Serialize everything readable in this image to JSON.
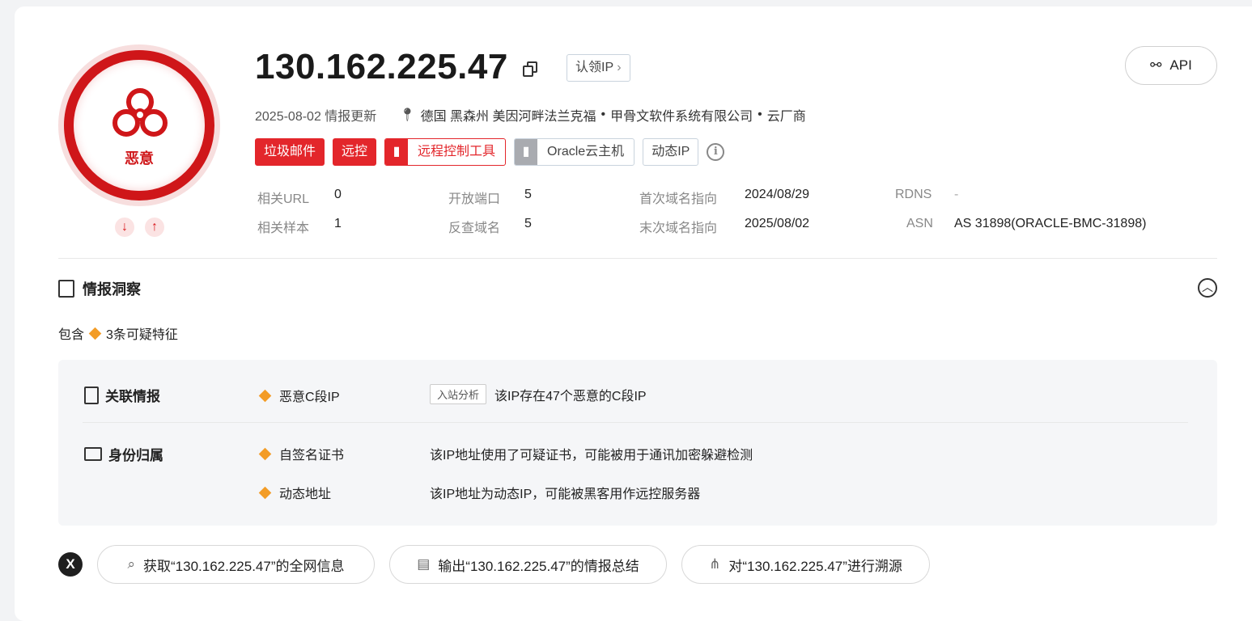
{
  "verdict": "恶意",
  "ip": "130.162.225.47",
  "claim_label": "认领IP",
  "api_label": "API",
  "meta": {
    "updated": "2025-08-02 情报更新",
    "location": "德国 黑森州 美因河畔法兰克福",
    "org": "甲骨文软件系统有限公司",
    "type": "云厂商"
  },
  "tags": [
    {
      "label": "垃圾邮件"
    },
    {
      "label": "远控"
    },
    {
      "label": "远程控制工具"
    },
    {
      "label": "Oracle云主机"
    },
    {
      "label": "动态IP"
    }
  ],
  "stats": {
    "related_url": {
      "label": "相关URL",
      "value": "0"
    },
    "open_ports": {
      "label": "开放端口",
      "value": "5"
    },
    "first_domain": {
      "label": "首次域名指向",
      "value": "2024/08/29"
    },
    "rdns": {
      "label": "RDNS",
      "value": "-"
    },
    "related_samples": {
      "label": "相关样本",
      "value": "1"
    },
    "reverse_domains": {
      "label": "反查域名",
      "value": "5"
    },
    "last_domain": {
      "label": "末次域名指向",
      "value": "2025/08/02"
    },
    "asn": {
      "label": "ASN",
      "value": "AS 31898(ORACLE-BMC-31898)"
    }
  },
  "insight": {
    "title": "情报洞察",
    "contain_prefix": "包含",
    "contain_count": "3条可疑特征",
    "groups": [
      {
        "title": "关联情报",
        "items": [
          {
            "name": "恶意C段IP",
            "badge": "入站分析",
            "desc": "该IP存在47个恶意的C段IP"
          }
        ]
      },
      {
        "title": "身份归属",
        "items": [
          {
            "name": "自签名证书",
            "desc": "该IP地址使用了可疑证书，可能被用于通讯加密躲避检测"
          },
          {
            "name": "动态地址",
            "desc": "该IP地址为动态IP，可能被黑客用作远控服务器"
          }
        ]
      }
    ]
  },
  "actions": [
    {
      "label": "获取“130.162.225.47”的全网信息"
    },
    {
      "label": "输出“130.162.225.47”的情报总结"
    },
    {
      "label": "对“130.162.225.47”进行溯源"
    }
  ],
  "colors": {
    "danger": "#e3262b",
    "warning": "#f39c26"
  }
}
